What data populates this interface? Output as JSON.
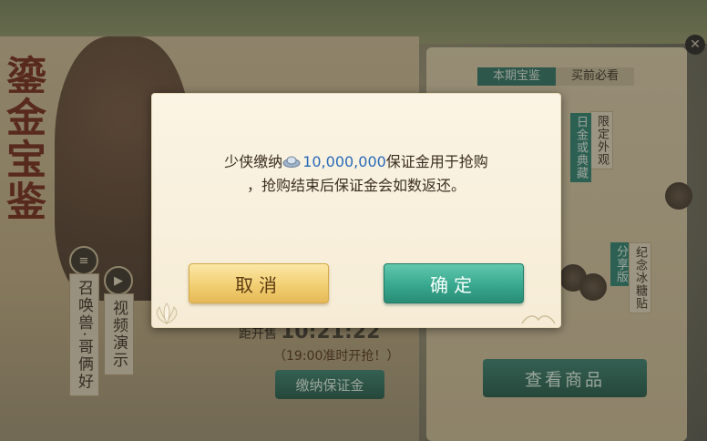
{
  "background": {
    "event_title": "鎏金宝鉴",
    "side_labels": {
      "summon": "召唤兽·哥俩好",
      "video": "视频演示"
    },
    "tabs": [
      {
        "label": "本期宝鉴",
        "active": true
      },
      {
        "label": "买前必看",
        "active": false
      }
    ],
    "tags": {
      "limited_outfit": "限定外观",
      "collection": "日金或典藏",
      "share_edition": "分享版",
      "souvenir": "纪念冰糖贴"
    },
    "countdown_prefix": "距开售",
    "countdown_value": "10:21:22",
    "start_notice": "（19:00准时开抢！）",
    "deposit_button": "缴纳保证金",
    "view_goods_button": "查看商品"
  },
  "dialog": {
    "line1_before": "少侠缴纳",
    "amount": "10,000,000",
    "line1_after": "保证金用于抢购",
    "line2": "，抢购结束后保证金会如数返还。",
    "cancel_label": "取消",
    "confirm_label": "确定"
  },
  "colors": {
    "amount": "#2a69b8",
    "cancel_button": "#f2cf73",
    "confirm_button": "#38a88e",
    "dialog_bg": "#fbf4e4"
  },
  "icons": [
    "silver-ingot-icon",
    "close-icon",
    "menu-icon",
    "play-icon",
    "lotus-icon",
    "wave-icon"
  ]
}
